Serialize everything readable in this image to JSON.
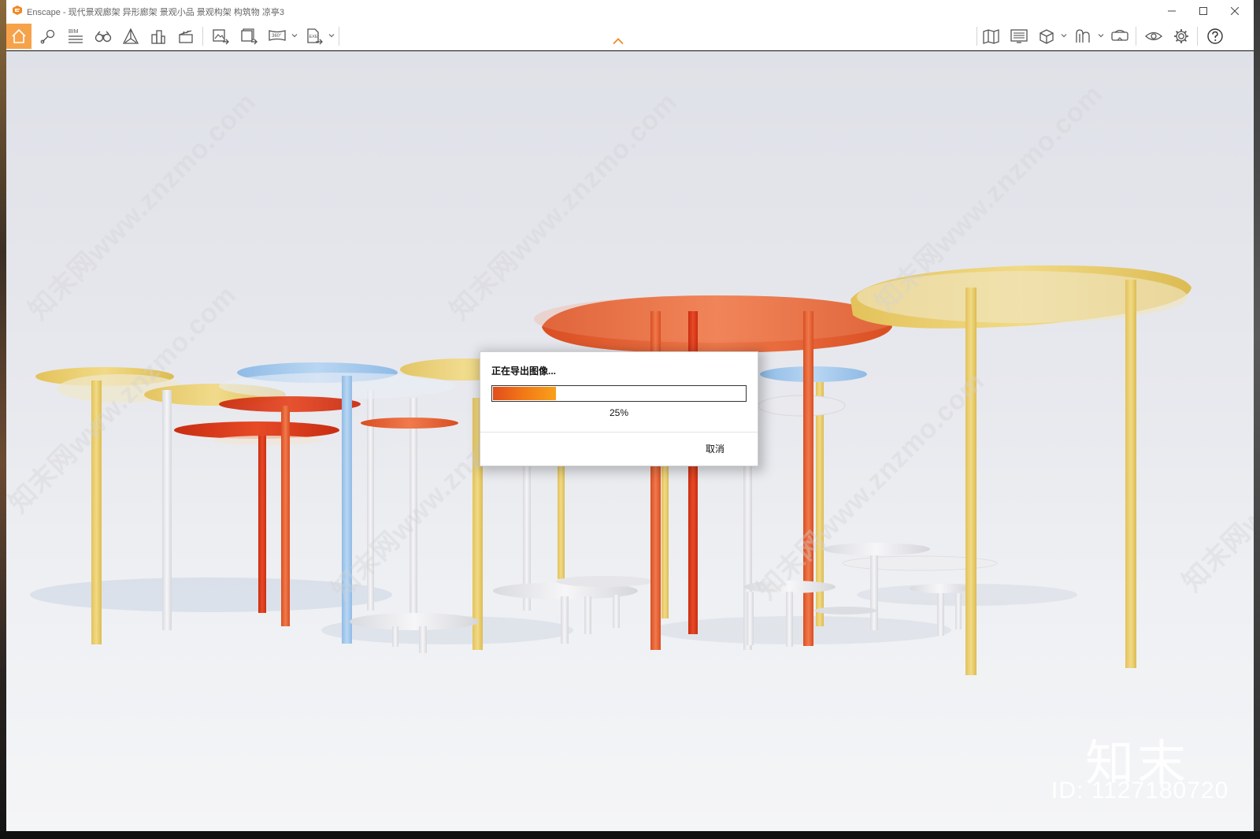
{
  "window": {
    "app_name": "Enscape",
    "title": "Enscape - 现代景观廊架 异形廊架 景观小品 景观构架 构筑物 凉亭3",
    "controls": [
      "minimize",
      "maximize",
      "close"
    ]
  },
  "toolbar": {
    "left_buttons": [
      {
        "name": "home",
        "icon": "house-icon",
        "active": true
      },
      {
        "name": "views",
        "icon": "location-pin-icon"
      },
      {
        "name": "bim",
        "icon": "bim-icon",
        "label": "BIM"
      },
      {
        "name": "binoculars",
        "icon": "binoculars-icon"
      },
      {
        "name": "atmosphere",
        "icon": "pyramid-icon"
      },
      {
        "name": "city",
        "icon": "buildings-icon"
      },
      {
        "name": "video",
        "icon": "clapperboard-icon"
      },
      {
        "name": "screenshot",
        "icon": "image-export-icon"
      },
      {
        "name": "batch-render",
        "icon": "batch-export-icon"
      },
      {
        "name": "panorama",
        "icon": "panorama-icon",
        "label": "360°"
      },
      {
        "name": "exe-export",
        "icon": "exe-export-icon",
        "label": "EXE"
      }
    ],
    "right_buttons": [
      {
        "name": "map",
        "icon": "map-icon"
      },
      {
        "name": "materials",
        "icon": "monitor-icon"
      },
      {
        "name": "asset-library",
        "icon": "cube-icon"
      },
      {
        "name": "sections",
        "icon": "section-icon"
      },
      {
        "name": "vr",
        "icon": "vr-headset-icon"
      },
      {
        "name": "visual-settings",
        "icon": "eye-icon"
      },
      {
        "name": "settings",
        "icon": "gear-icon"
      },
      {
        "name": "help",
        "icon": "help-icon"
      }
    ],
    "active_color": "#f6a24a"
  },
  "dialog": {
    "title": "正在导出图像...",
    "progress": 0.25,
    "progress_text": "25%",
    "cancel_label": "取消"
  },
  "watermarks": {
    "site": "知末网www.znzmo.com",
    "brand": "知末",
    "id_text": "ID: 1127180720"
  },
  "colors": {
    "accent": "#f6a24a",
    "progress_start": "#e24d1c",
    "progress_end": "#f9a01a",
    "canopy_yellow": "#ead06a",
    "canopy_orange": "#e66a3c",
    "canopy_red": "#d9391b",
    "canopy_blue": "#9ec5ea",
    "post_white": "#f4f4f5"
  }
}
